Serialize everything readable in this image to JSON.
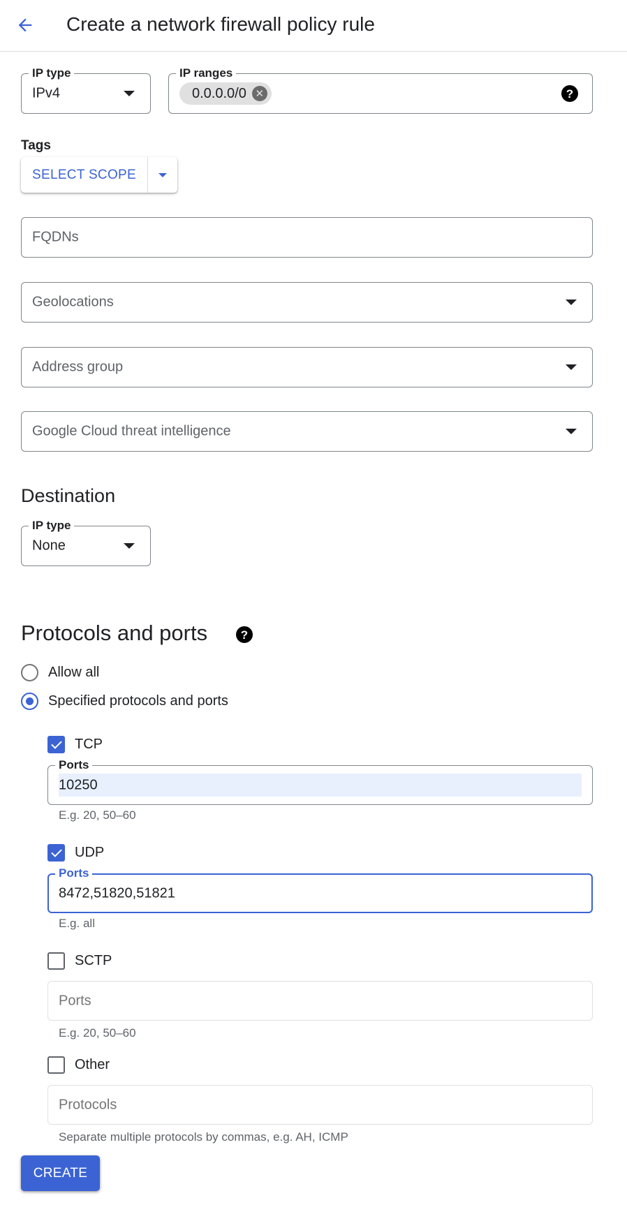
{
  "header": {
    "title": "Create a network firewall policy rule",
    "back_icon": "arrow-back-icon"
  },
  "source": {
    "ip_type": {
      "label": "IP type",
      "value": "IPv4"
    },
    "ip_ranges": {
      "label": "IP ranges",
      "chips": [
        "0.0.0.0/0"
      ],
      "help_icon": "?"
    },
    "tags": {
      "label": "Tags",
      "select_scope_label": "SELECT SCOPE"
    },
    "fqdns": {
      "placeholder": "FQDNs"
    },
    "geolocations": {
      "placeholder": "Geolocations"
    },
    "address_group": {
      "placeholder": "Address group"
    },
    "threat_intelligence": {
      "placeholder": "Google Cloud threat intelligence"
    }
  },
  "destination": {
    "heading": "Destination",
    "ip_type": {
      "label": "IP type",
      "value": "None"
    }
  },
  "protocols": {
    "heading": "Protocols and ports",
    "help_icon": "?",
    "options": [
      {
        "label": "Allow all",
        "selected": false
      },
      {
        "label": "Specified protocols and ports",
        "selected": true
      }
    ],
    "tcp": {
      "label": "TCP",
      "checked": true,
      "ports_label": "Ports",
      "ports_value": "10250",
      "helper": "E.g. 20, 50–60"
    },
    "udp": {
      "label": "UDP",
      "checked": true,
      "ports_label": "Ports",
      "ports_value": "8472,51820,51821",
      "helper": "E.g. all"
    },
    "sctp": {
      "label": "SCTP",
      "checked": false,
      "ports_placeholder": "Ports",
      "helper": "E.g. 20, 50–60"
    },
    "other": {
      "label": "Other",
      "checked": false,
      "protocols_placeholder": "Protocols",
      "helper": "Separate multiple protocols by commas, e.g. AH, ICMP"
    }
  },
  "actions": {
    "create_label": "CREATE"
  },
  "colors": {
    "accent": "#3b63d3",
    "autofill": "#e8f0fe",
    "chip": "#e0e0e0"
  }
}
